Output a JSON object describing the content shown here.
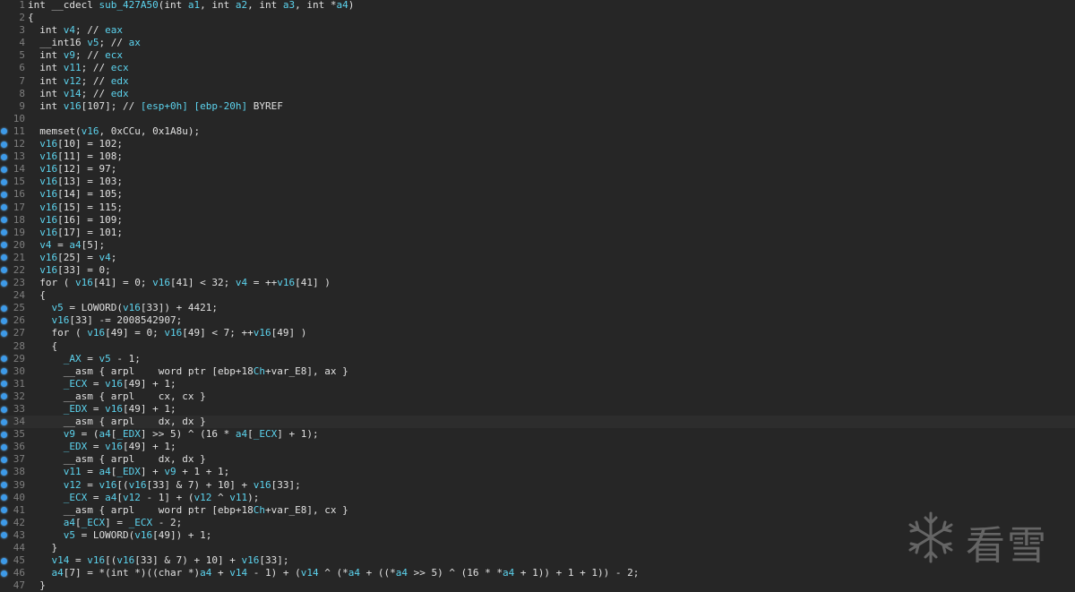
{
  "code": {
    "lines": [
      {
        "n": "1",
        "bp": false,
        "t": "int __cdecl sub_427A50(int a1, int a2, int a3, int *a4)"
      },
      {
        "n": "2",
        "bp": false,
        "t": "{"
      },
      {
        "n": "3",
        "bp": false,
        "t": "  int v4; // eax"
      },
      {
        "n": "4",
        "bp": false,
        "t": "  __int16 v5; // ax"
      },
      {
        "n": "5",
        "bp": false,
        "t": "  int v9; // ecx"
      },
      {
        "n": "6",
        "bp": false,
        "t": "  int v11; // ecx"
      },
      {
        "n": "7",
        "bp": false,
        "t": "  int v12; // edx"
      },
      {
        "n": "8",
        "bp": false,
        "t": "  int v14; // edx"
      },
      {
        "n": "9",
        "bp": false,
        "t": "  int v16[107]; // [esp+0h] [ebp-20h] BYREF"
      },
      {
        "n": "10",
        "bp": false,
        "t": ""
      },
      {
        "n": "11",
        "bp": true,
        "t": "  memset(v16, 0xCCu, 0x1A8u);"
      },
      {
        "n": "12",
        "bp": true,
        "t": "  v16[10] = 102;"
      },
      {
        "n": "13",
        "bp": true,
        "t": "  v16[11] = 108;"
      },
      {
        "n": "14",
        "bp": true,
        "t": "  v16[12] = 97;"
      },
      {
        "n": "15",
        "bp": true,
        "t": "  v16[13] = 103;"
      },
      {
        "n": "16",
        "bp": true,
        "t": "  v16[14] = 105;"
      },
      {
        "n": "17",
        "bp": true,
        "t": "  v16[15] = 115;"
      },
      {
        "n": "18",
        "bp": true,
        "t": "  v16[16] = 109;"
      },
      {
        "n": "19",
        "bp": true,
        "t": "  v16[17] = 101;"
      },
      {
        "n": "20",
        "bp": true,
        "t": "  v4 = a4[5];"
      },
      {
        "n": "21",
        "bp": true,
        "t": "  v16[25] = v4;"
      },
      {
        "n": "22",
        "bp": true,
        "t": "  v16[33] = 0;"
      },
      {
        "n": "23",
        "bp": true,
        "t": "  for ( v16[41] = 0; v16[41] < 32; v4 = ++v16[41] )"
      },
      {
        "n": "24",
        "bp": false,
        "t": "  {"
      },
      {
        "n": "25",
        "bp": true,
        "t": "    v5 = LOWORD(v16[33]) + 4421;"
      },
      {
        "n": "26",
        "bp": true,
        "t": "    v16[33] -= 2008542907;"
      },
      {
        "n": "27",
        "bp": true,
        "t": "    for ( v16[49] = 0; v16[49] < 7; ++v16[49] )"
      },
      {
        "n": "28",
        "bp": false,
        "t": "    {"
      },
      {
        "n": "29",
        "bp": true,
        "t": "      _AX = v5 - 1;"
      },
      {
        "n": "30",
        "bp": true,
        "t": "      __asm { arpl    word ptr [ebp+18Ch+var_E8], ax }"
      },
      {
        "n": "31",
        "bp": true,
        "t": "      _ECX = v16[49] + 1;"
      },
      {
        "n": "32",
        "bp": true,
        "t": "      __asm { arpl    cx, cx }"
      },
      {
        "n": "33",
        "bp": true,
        "t": "      _EDX = v16[49] + 1;"
      },
      {
        "n": "34",
        "bp": true,
        "t": "      __asm { arpl    dx, dx }"
      },
      {
        "n": "35",
        "bp": true,
        "t": "      v9 = (a4[_EDX] >> 5) ^ (16 * a4[_ECX] + 1);"
      },
      {
        "n": "36",
        "bp": true,
        "t": "      _EDX = v16[49] + 1;"
      },
      {
        "n": "37",
        "bp": true,
        "t": "      __asm { arpl    dx, dx }"
      },
      {
        "n": "38",
        "bp": true,
        "t": "      v11 = a4[_EDX] + v9 + 1 + 1;"
      },
      {
        "n": "39",
        "bp": true,
        "t": "      v12 = v16[(v16[33] & 7) + 10] + v16[33];"
      },
      {
        "n": "40",
        "bp": true,
        "t": "      _ECX = a4[v12 - 1] + (v12 ^ v11);"
      },
      {
        "n": "41",
        "bp": true,
        "t": "      __asm { arpl    word ptr [ebp+18Ch+var_E8], cx }"
      },
      {
        "n": "42",
        "bp": true,
        "t": "      a4[_ECX] = _ECX - 2;"
      },
      {
        "n": "43",
        "bp": true,
        "t": "      v5 = LOWORD(v16[49]) + 1;"
      },
      {
        "n": "44",
        "bp": false,
        "t": "    }"
      },
      {
        "n": "45",
        "bp": true,
        "t": "    v14 = v16[(v16[33] & 7) + 10] + v16[33];"
      },
      {
        "n": "46",
        "bp": true,
        "t": "    a4[7] = *(int *)((char *)a4 + v14 - 1) + (v14 ^ (*a4 + ((*a4 >> 5) ^ (16 * *a4 + 1)) + 1 + 1)) - 2;"
      },
      {
        "n": "47",
        "bp": false,
        "t": "  }"
      }
    ]
  },
  "watermark": {
    "icon": "snowflake-icon",
    "text": "看雪"
  },
  "colors": {
    "background": "#262626",
    "identifier": "#5cd3ee",
    "text": "#e0e0e0",
    "line_number": "#7e7e7e",
    "breakpoint": "#3d9ae8"
  }
}
